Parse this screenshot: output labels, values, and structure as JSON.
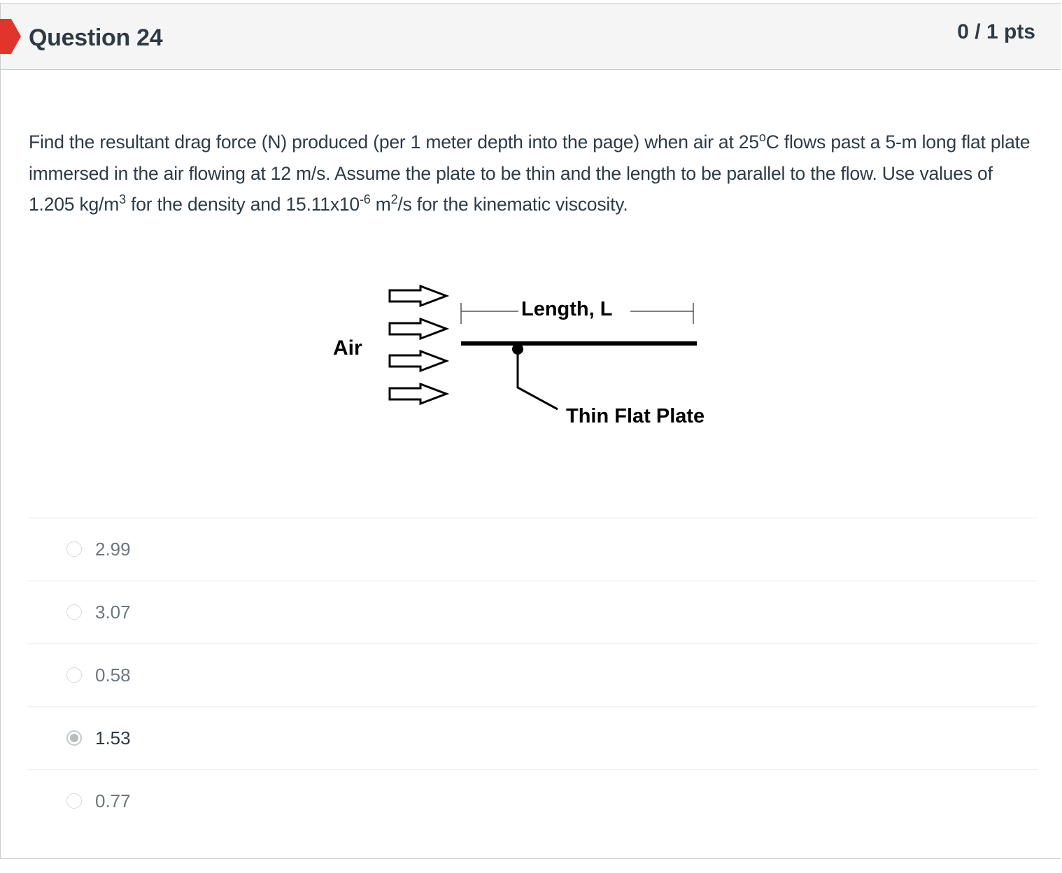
{
  "question": {
    "title": "Question 24",
    "points": "0 / 1 pts",
    "flag_color": "#e0342d",
    "text": {
      "p1": "Find the resultant drag force (N) produced (per 1 meter depth into the page) when air at 25",
      "deg": "o",
      "p2": "C flows past a 5-m long flat plate immersed in the air flowing at 12 m/s.   Assume the plate to be thin and the length to be parallel to the flow.    Use values of 1.205 kg/m",
      "sup1": "3",
      "p3": " for the density and 15.11x10",
      "sup2": "-6",
      "p4": " m",
      "sup3": "2",
      "p5": "/s for the kinematic viscosity."
    }
  },
  "diagram": {
    "air_label": "Air",
    "length_label": "Length, L",
    "plate_label": "Thin Flat Plate"
  },
  "answers": [
    {
      "value": "2.99",
      "selected": false
    },
    {
      "value": "3.07",
      "selected": false
    },
    {
      "value": "0.58",
      "selected": false
    },
    {
      "value": "1.53",
      "selected": true
    },
    {
      "value": "0.77",
      "selected": false
    }
  ]
}
